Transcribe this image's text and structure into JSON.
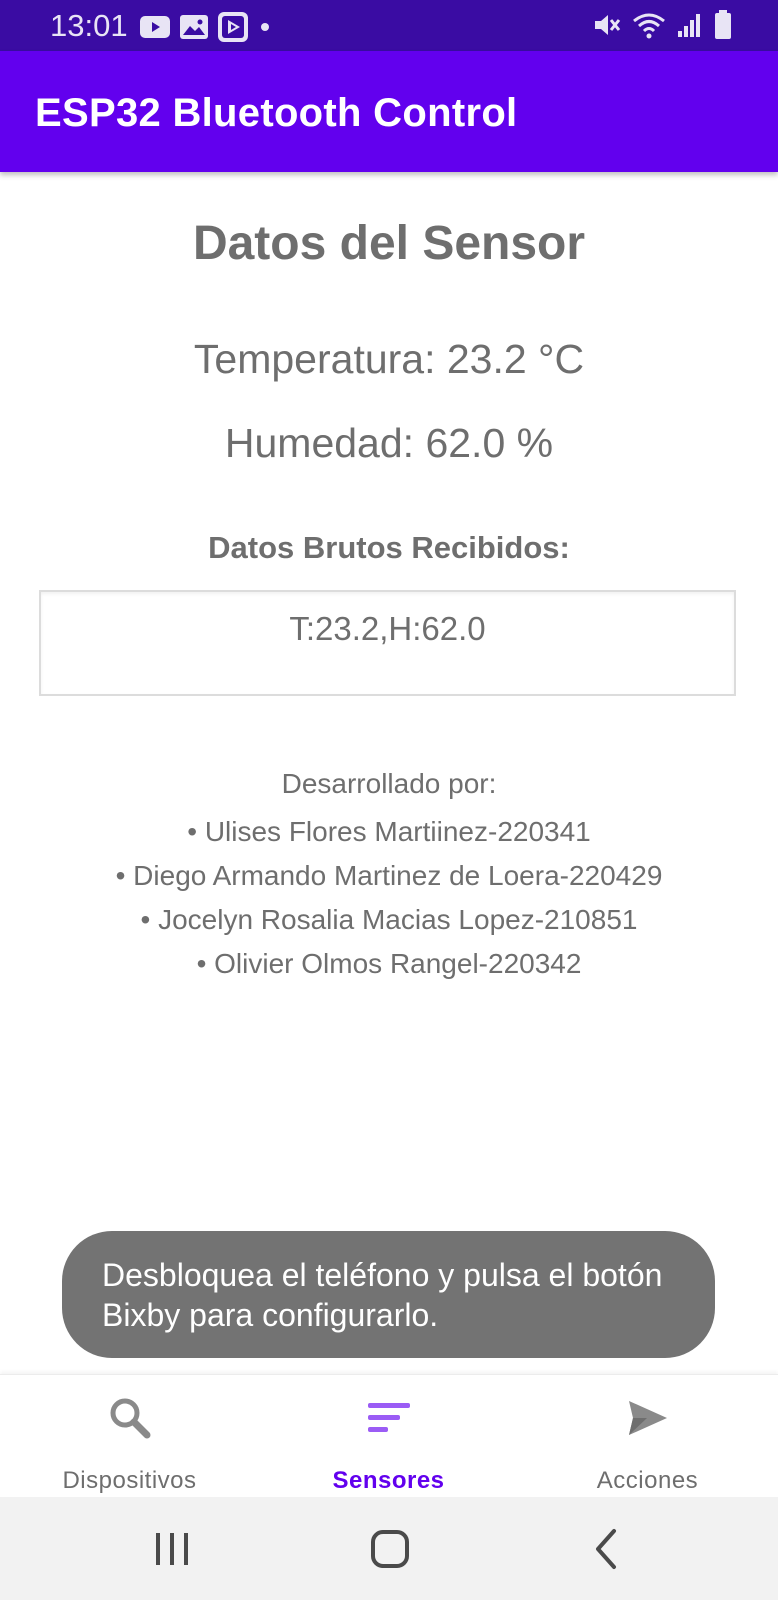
{
  "status_bar": {
    "time": "13:01",
    "left_icons": [
      "youtube-icon",
      "gallery-icon",
      "play-store-icon",
      "dot-icon"
    ],
    "right_icons": [
      "mute-icon",
      "wifi-icon",
      "signal-icon",
      "battery-icon"
    ],
    "background": "#3a0ca3"
  },
  "app_bar": {
    "title": "ESP32 Bluetooth Control",
    "background": "#6200ee"
  },
  "sensor": {
    "title": "Datos del Sensor",
    "temperature_line": "Temperatura: 23.2 °C",
    "humidity_line": "Humedad: 62.0 %",
    "raw_heading": "Datos Brutos Recibidos:",
    "raw_value": "T:23.2,H:62.0"
  },
  "developers": {
    "heading": "Desarrollado por:",
    "items": [
      "• Ulises Flores Martiinez-220341",
      "• Diego Armando Martinez de Loera-220429",
      "• Jocelyn Rosalia Macias Lopez-210851",
      "• Olivier Olmos Rangel-220342"
    ]
  },
  "toast": {
    "text": "Desbloquea el teléfono y pulsa el botón Bixby para configurarlo."
  },
  "bottom_nav": {
    "items": [
      {
        "label": "Dispositivos",
        "icon": "search-icon",
        "active": false
      },
      {
        "label": "Sensores",
        "icon": "sort-lines-icon",
        "active": true
      },
      {
        "label": "Acciones",
        "icon": "send-icon",
        "active": false
      }
    ],
    "active_color": "#6200ee"
  },
  "system_nav": {
    "buttons": [
      "recent-apps-icon",
      "home-icon",
      "back-icon"
    ]
  }
}
